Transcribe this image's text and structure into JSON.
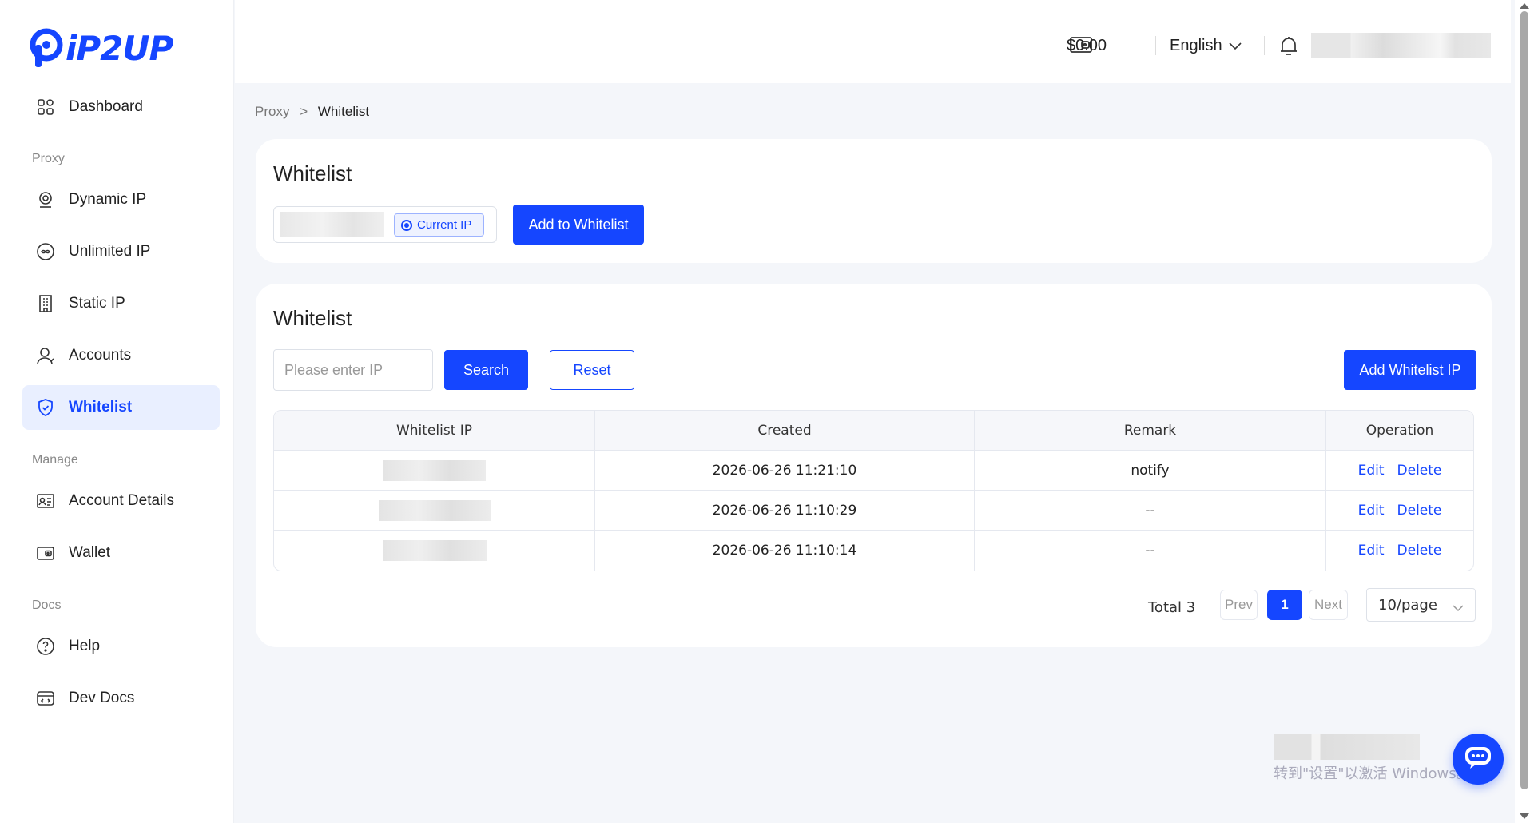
{
  "brand": {
    "logo_text": "iP2UP",
    "accent": "#1546ff"
  },
  "sidebar": {
    "dashboard": "Dashboard",
    "section_proxy": "Proxy",
    "dynamic_ip": "Dynamic IP",
    "unlimited_ip": "Unlimited IP",
    "static_ip": "Static IP",
    "accounts": "Accounts",
    "whitelist": "Whitelist",
    "section_manage": "Manage",
    "account_details": "Account Details",
    "wallet": "Wallet",
    "section_docs": "Docs",
    "help": "Help",
    "dev_docs": "Dev Docs"
  },
  "header": {
    "balance": "$0.00",
    "language": "English"
  },
  "breadcrumb": {
    "parent": "Proxy",
    "separator": ">",
    "current": "Whitelist"
  },
  "add_card": {
    "title": "Whitelist",
    "current_ip_label": "Current IP",
    "add_button": "Add to Whitelist"
  },
  "list_card": {
    "title": "Whitelist",
    "search_placeholder": "Please enter IP",
    "search_button": "Search",
    "reset_button": "Reset",
    "add_ip_button": "Add Whitelist IP",
    "columns": [
      "Whitelist IP",
      "Created",
      "Remark",
      "Operation"
    ],
    "rows": [
      {
        "created": "2026-06-26 11:21:10",
        "remark": "notify"
      },
      {
        "created": "2026-06-26 11:10:29",
        "remark": "--"
      },
      {
        "created": "2026-06-26 11:10:14",
        "remark": "--"
      }
    ],
    "edit_label": "Edit",
    "delete_label": "Delete"
  },
  "pagination": {
    "total": "Total 3",
    "prev": "Prev",
    "current": "1",
    "next": "Next",
    "page_size": "10/page"
  },
  "watermark": {
    "text": "转到\"设置\"以激活 Windows。"
  }
}
